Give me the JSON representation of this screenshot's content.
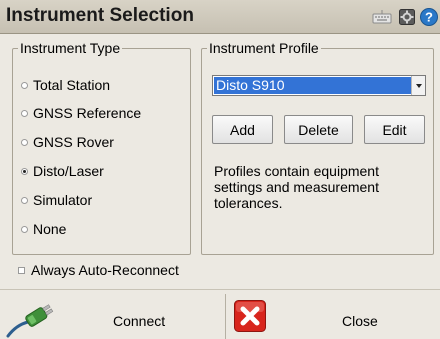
{
  "window": {
    "title": "Instrument Selection",
    "icons": [
      "keyboard-icon",
      "settings-icon",
      "help-icon"
    ]
  },
  "instrument_type": {
    "label": "Instrument Type",
    "options": [
      "Total Station",
      "GNSS Reference",
      "GNSS Rover",
      "Disto/Laser",
      "Simulator",
      "None"
    ],
    "selected": "Disto/Laser"
  },
  "instrument_profile": {
    "label": "Instrument Profile",
    "selected_value": "Disto S910",
    "buttons": {
      "add": "Add",
      "delete": "Delete",
      "edit": "Edit"
    },
    "description": "Profiles contain equipment settings and measurement tolerances."
  },
  "auto_reconnect": {
    "label": "Always Auto-Reconnect",
    "checked": false
  },
  "footer": {
    "connect_label": "Connect",
    "close_label": "Close",
    "connect_icon": "connector-plug-icon",
    "close_icon": "close-x-icon"
  },
  "colors": {
    "accent_selection": "#3373d6",
    "close_red": "#d8251d",
    "help_blue": "#2a78c8"
  }
}
